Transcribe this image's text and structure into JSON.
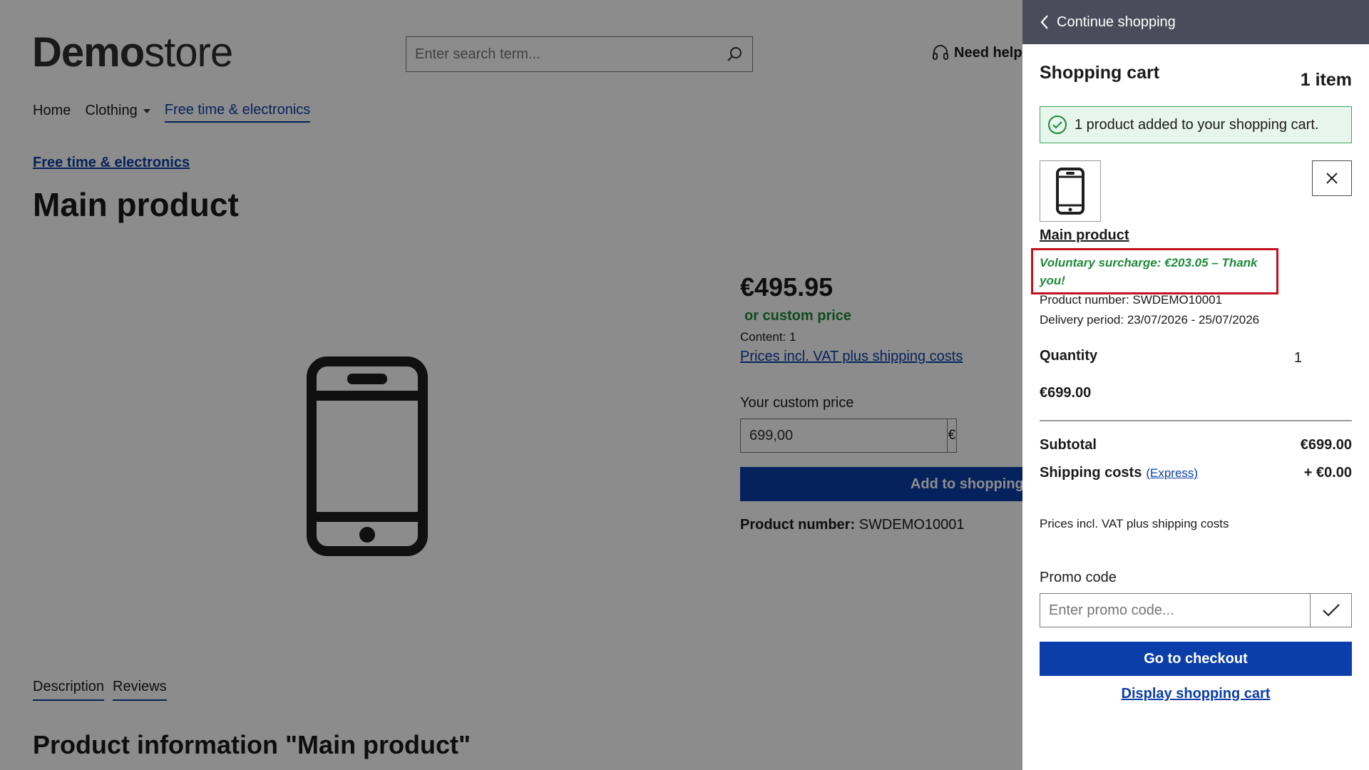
{
  "header": {
    "logo_bold": "Demo",
    "logo_light": "store",
    "search_placeholder": "Enter search term...",
    "help_label": "Need help"
  },
  "nav": {
    "items": [
      {
        "label": "Home"
      },
      {
        "label": "Clothing"
      },
      {
        "label": "Free time & electronics"
      }
    ]
  },
  "breadcrumb": "Free time & electronics",
  "product": {
    "title": "Main product",
    "price": "€495.95",
    "custom_price_note": "or custom price",
    "content": "Content: 1",
    "vat_link": "Prices incl. VAT plus shipping costs",
    "custom_price_label": "Your custom price",
    "custom_price_value": "699,00",
    "currency_symbol": "€",
    "add_to_cart_label": "Add to shopping cart",
    "product_number_label": "Product number:",
    "product_number": "SWDEMO10001",
    "tabs": [
      {
        "label": "Description"
      },
      {
        "label": "Reviews"
      }
    ],
    "info_title": "Product information \"Main product\""
  },
  "cart": {
    "continue_label": "Continue shopping",
    "title": "Shopping cart",
    "count": "1 item",
    "alert": "1 product added to your shopping cart.",
    "item": {
      "name": "Main product",
      "surcharge": "Voluntary surcharge: €203.05 – Thank you!",
      "product_number": "Product number: SWDEMO10001",
      "delivery": "Delivery period: 23/07/2026 - 25/07/2026",
      "quantity_label": "Quantity",
      "quantity": "1",
      "price": "€699.00"
    },
    "subtotal_label": "Subtotal",
    "subtotal": "€699.00",
    "shipping_label": "Shipping costs",
    "shipping_method": "(Express)",
    "shipping": "+ €0.00",
    "vat_note": "Prices incl. VAT plus shipping costs",
    "promo_label": "Promo code",
    "promo_placeholder": "Enter promo code...",
    "checkout_label": "Go to checkout",
    "display_cart_label": "Display shopping cart"
  },
  "colors": {
    "primary": "#0b3ea8",
    "success": "#1d8a3a",
    "highlight_border": "#c2121e",
    "offcanvas_header": "#4a4c5c"
  }
}
